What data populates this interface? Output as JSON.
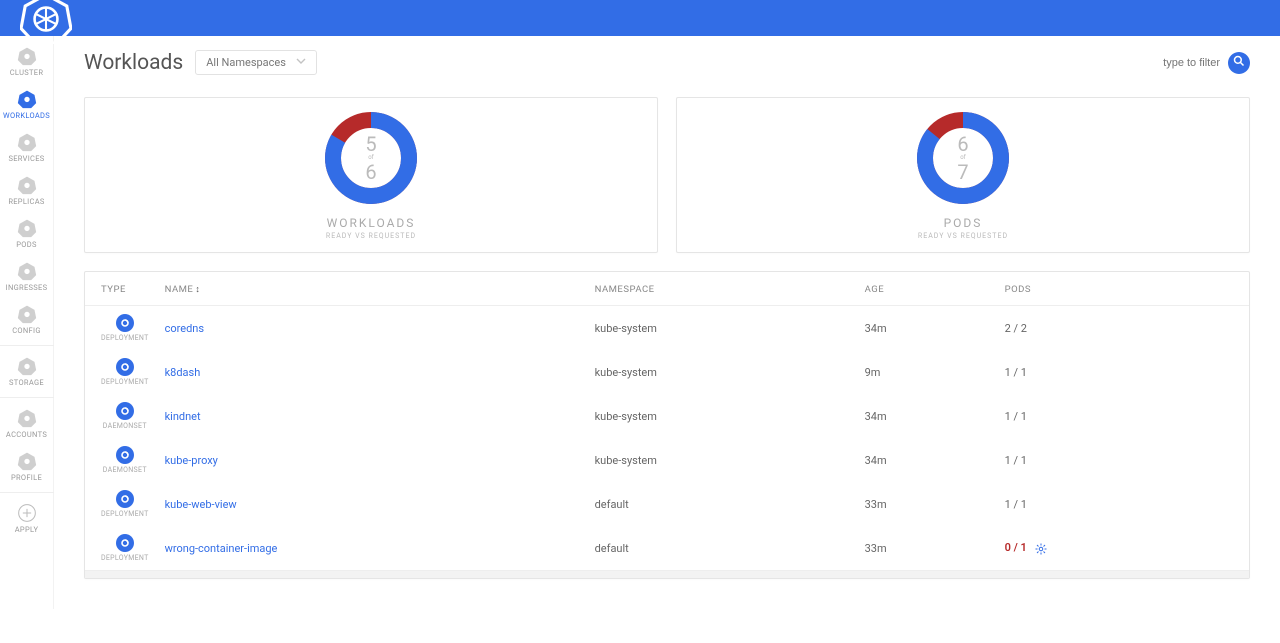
{
  "page": {
    "title": "Workloads",
    "namespace_selector": "All Namespaces",
    "filter_placeholder": "type to filter"
  },
  "sidebar": {
    "items": [
      {
        "label": "CLUSTER",
        "icon": "hex"
      },
      {
        "label": "WORKLOADS",
        "icon": "hex-ring",
        "active": true
      },
      {
        "label": "SERVICES",
        "icon": "hex"
      },
      {
        "label": "REPLICAS",
        "icon": "hex"
      },
      {
        "label": "PODS",
        "icon": "hex"
      },
      {
        "label": "INGRESSES",
        "icon": "hex"
      },
      {
        "label": "CONFIG",
        "icon": "hex"
      },
      {
        "label": "STORAGE",
        "icon": "hex",
        "divider": true
      },
      {
        "label": "ACCOUNTS",
        "icon": "hex",
        "divider": true
      },
      {
        "label": "PROFILE",
        "icon": "hex"
      },
      {
        "label": "APPLY",
        "icon": "plus",
        "divider": true
      }
    ]
  },
  "chart_data": [
    {
      "type": "pie",
      "title": "WORKLOADS",
      "subtitle": "READY VS REQUESTED",
      "ready": 5,
      "requested": 6,
      "of_label": "of"
    },
    {
      "type": "pie",
      "title": "PODS",
      "subtitle": "READY VS REQUESTED",
      "ready": 6,
      "requested": 7,
      "of_label": "of"
    }
  ],
  "table": {
    "columns": {
      "type": "TYPE",
      "name": "NAME",
      "namespace": "NAMESPACE",
      "age": "AGE",
      "pods": "PODS"
    },
    "sort_indicator": "↕",
    "rows": [
      {
        "type": "DEPLOYMENT",
        "name": "coredns",
        "namespace": "kube-system",
        "age": "34m",
        "pods": "2 / 2",
        "healthy": true
      },
      {
        "type": "DEPLOYMENT",
        "name": "k8dash",
        "namespace": "kube-system",
        "age": "9m",
        "pods": "1 / 1",
        "healthy": true
      },
      {
        "type": "DAEMONSET",
        "name": "kindnet",
        "namespace": "kube-system",
        "age": "34m",
        "pods": "1 / 1",
        "healthy": true
      },
      {
        "type": "DAEMONSET",
        "name": "kube-proxy",
        "namespace": "kube-system",
        "age": "34m",
        "pods": "1 / 1",
        "healthy": true
      },
      {
        "type": "DEPLOYMENT",
        "name": "kube-web-view",
        "namespace": "default",
        "age": "33m",
        "pods": "1 / 1",
        "healthy": true
      },
      {
        "type": "DEPLOYMENT",
        "name": "wrong-container-image",
        "namespace": "default",
        "age": "33m",
        "pods": "0 / 1",
        "healthy": false
      }
    ]
  }
}
